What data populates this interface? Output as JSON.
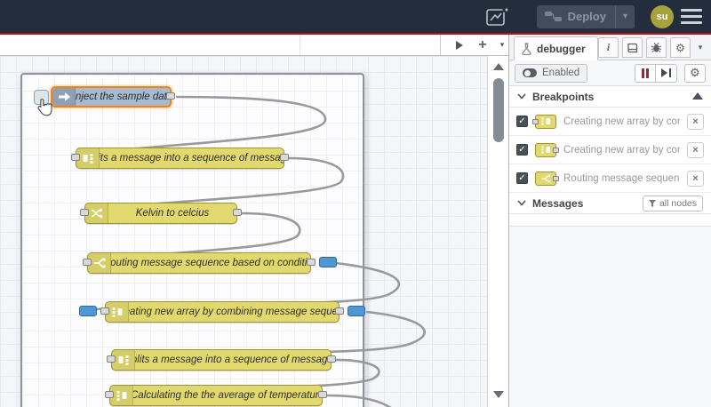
{
  "header": {
    "deploy_label": "Deploy",
    "avatar_initials": "su"
  },
  "icons": {
    "caret_down": "▾",
    "gear": "⚙",
    "info": "i",
    "plus": "+",
    "close": "×",
    "check": "✓"
  },
  "workspace": {
    "nodes": [
      {
        "type": "inject",
        "label": "Inject the sample data",
        "selected": true
      },
      {
        "type": "split",
        "label": "Splits a message into a sequence of messages."
      },
      {
        "type": "change",
        "label": "Kelvin to celcius"
      },
      {
        "type": "switch",
        "label": "Routing message sequence based on condition",
        "breakpoint_out": true
      },
      {
        "type": "join",
        "label": "Creating new array by combining message sequence",
        "breakpoint_in": true,
        "breakpoint_out": true
      },
      {
        "type": "split",
        "label": "Splits a message into a sequence of messages."
      },
      {
        "type": "join",
        "label": "Calculating the the average of temperature"
      }
    ],
    "colors": {
      "node_yellow": "#e2d96e",
      "node_inject": "#a6bbcf",
      "selected_border": "#ff7f0e",
      "breakpoint_blue": "#4f97d4",
      "wire": "#999999"
    }
  },
  "sidebar": {
    "tab_label": "debugger",
    "toolbar": {
      "enabled_label": "Enabled"
    },
    "sections": {
      "breakpoints_title": "Breakpoints",
      "messages_title": "Messages",
      "messages_filter_label": "all nodes"
    },
    "breakpoints": [
      {
        "type": "join",
        "port": "input",
        "label": "Creating new array by combining message sequence"
      },
      {
        "type": "join",
        "port": "output",
        "label": "Creating new array by combining message sequence"
      },
      {
        "type": "switch",
        "port": "output",
        "label": "Routing message sequence based on condition"
      }
    ]
  }
}
